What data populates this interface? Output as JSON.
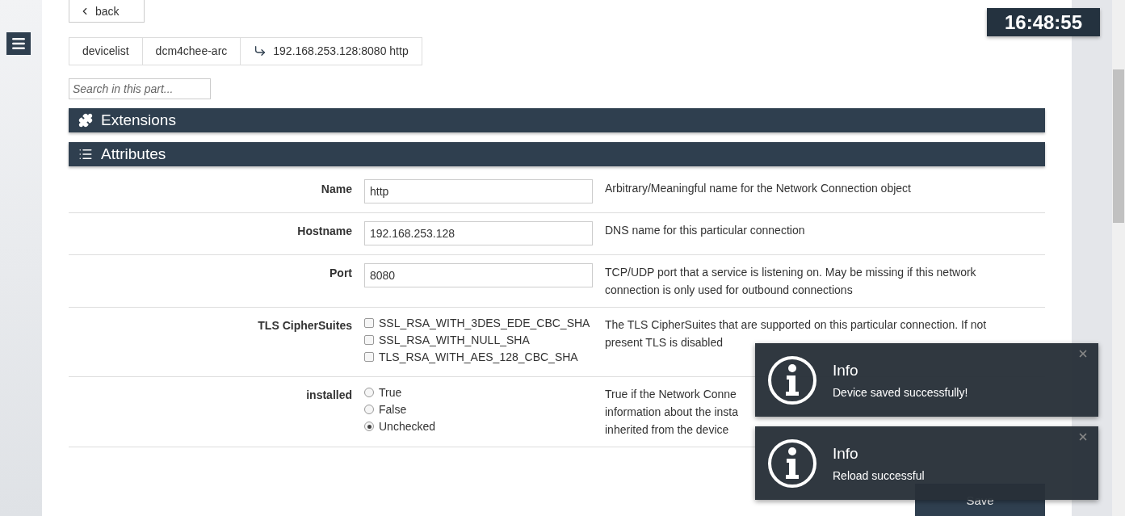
{
  "clock": "16:48:55",
  "back_button": {
    "label": "back"
  },
  "breadcrumb": [
    {
      "label": "devicelist",
      "kind": "plain"
    },
    {
      "label": "dcm4chee-arc",
      "kind": "plain"
    },
    {
      "label": "192.168.253.128:8080 http",
      "kind": "current"
    }
  ],
  "search": {
    "placeholder": "Search in this part..."
  },
  "extensions_bar": {
    "title": "Extensions"
  },
  "attributes_bar": {
    "title": "Attributes"
  },
  "attributes": [
    {
      "kind": "text",
      "label": "Name",
      "value": "http",
      "description": "Arbitrary/Meaningful name for the Network Connection object"
    },
    {
      "kind": "text",
      "label": "Hostname",
      "value": "192.168.253.128",
      "description": "DNS name for this particular connection"
    },
    {
      "kind": "text",
      "label": "Port",
      "value": "8080",
      "description": "TCP/UDP port that a service is listening on. May be missing if this network connection is only used for outbound connections"
    },
    {
      "kind": "checkboxes",
      "label": "TLS CipherSuites",
      "options": [
        {
          "label": "SSL_RSA_WITH_3DES_EDE_CBC_SHA",
          "checked": false
        },
        {
          "label": "SSL_RSA_WITH_NULL_SHA",
          "checked": false
        },
        {
          "label": "TLS_RSA_WITH_AES_128_CBC_SHA",
          "checked": false
        }
      ],
      "description": "The TLS CipherSuites that are supported on this particular connection. If not present TLS is disabled"
    },
    {
      "kind": "radios",
      "label": "installed",
      "options": [
        {
          "label": "True",
          "selected": false
        },
        {
          "label": "False",
          "selected": false
        },
        {
          "label": "Unchecked",
          "selected": true
        }
      ],
      "description_lines": [
        "True if the Network Conne",
        "information about the insta",
        "inherited from the device"
      ]
    }
  ],
  "save_button": {
    "label": "Save"
  },
  "toasts": [
    {
      "title": "Info",
      "message": "Device saved successfully!"
    },
    {
      "title": "Info",
      "message": "Reload successful"
    }
  ]
}
